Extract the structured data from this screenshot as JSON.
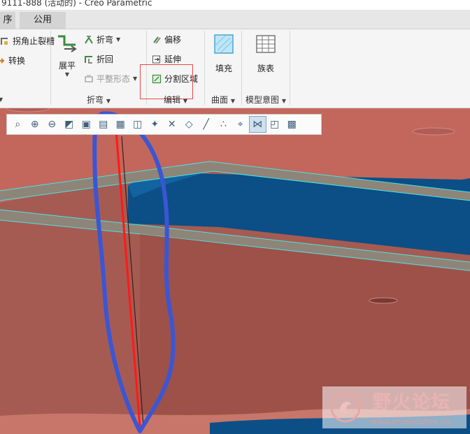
{
  "window": {
    "title": "9111-888 (活动的) - Creo Parametric"
  },
  "tabs": [
    {
      "label": "序"
    },
    {
      "label": "公用"
    }
  ],
  "ribbon": {
    "left_group": {
      "items": [
        {
          "label": "拐角止裂槽",
          "icon": "corner-relief-icon"
        },
        {
          "label": "转换",
          "icon": "convert-icon"
        }
      ]
    },
    "bend": {
      "unbend_label": "展平",
      "bend_label": "折弯",
      "bendback_label": "折回",
      "flatten_label": "平整形态",
      "group_label": "折弯"
    },
    "edit": {
      "offset_label": "偏移",
      "extend_label": "延伸",
      "split_label": "分割区域",
      "group_label": "编辑"
    },
    "surface": {
      "fill_label": "填充",
      "group_label": "曲面"
    },
    "model_intent": {
      "family_label": "族表",
      "group_label": "模型意图"
    }
  },
  "graphics_toolbar": {
    "buttons": [
      "refit-icon",
      "zoom-in-icon",
      "zoom-out-icon",
      "repaint-icon",
      "shading-icon",
      "saved-views-icon",
      "view-manager-icon",
      "perspective-icon",
      "spin-center-icon",
      "datum-display-icon",
      "plane-display-icon",
      "axis-display-icon",
      "point-display-icon",
      "csys-display-icon",
      "annotation-display-icon",
      "appearance-icon",
      "render-icon"
    ],
    "active_index": 14
  },
  "watermark": {
    "text": "野火论坛",
    "url": "www.proewildfire.cn"
  },
  "colors": {
    "model_top": "#c0655a",
    "model_side": "#9c5048",
    "cavity_blue": "#0b4f86",
    "highlight_red": "#ff1a1a",
    "annotation_blue": "#3a56d4",
    "edge_cyan": "#46e6e6"
  }
}
